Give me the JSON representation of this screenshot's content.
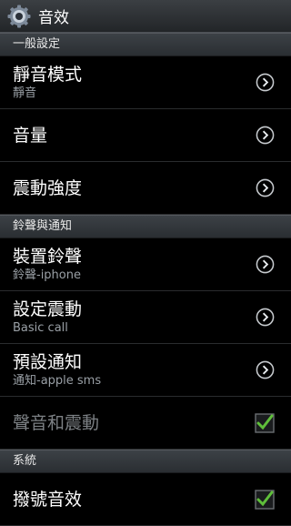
{
  "header": {
    "title": "音效",
    "icon": "gear-icon"
  },
  "sections": [
    {
      "title": "一般設定"
    },
    {
      "title": "鈴聲與通知"
    },
    {
      "title": "系統"
    }
  ],
  "general": [
    {
      "label": "靜音模式",
      "sub": "靜音"
    },
    {
      "label": "音量"
    },
    {
      "label": "震動強度"
    }
  ],
  "ringtones": [
    {
      "label": "裝置鈴聲",
      "sub": "鈴聲-iphone"
    },
    {
      "label": "設定震動",
      "sub": "Basic call"
    },
    {
      "label": "預設通知",
      "sub": "通知-apple sms"
    },
    {
      "label": "聲音和震動",
      "checked": true
    }
  ],
  "system": [
    {
      "label": "撥號音效",
      "checked": true
    }
  ],
  "colors": {
    "check": "#5fbf3a",
    "accent_bg": "#2a2e32"
  }
}
